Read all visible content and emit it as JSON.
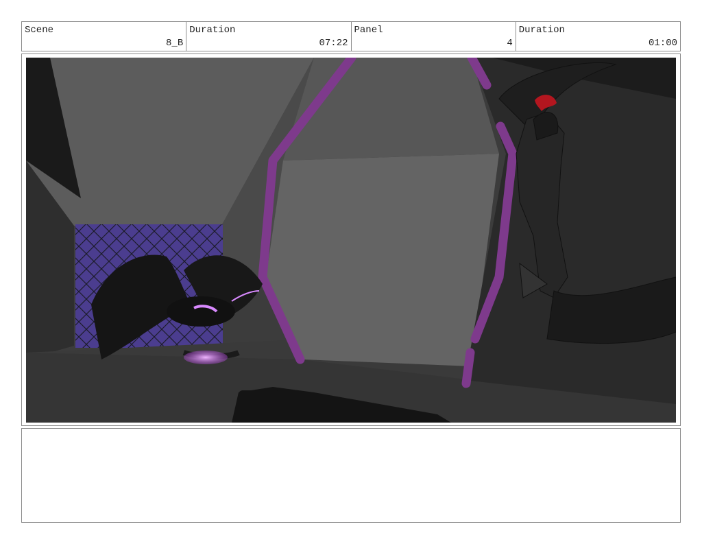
{
  "header": {
    "scene": {
      "label": "Scene",
      "value": "8_B"
    },
    "scene_duration": {
      "label": "Duration",
      "value": "07:22"
    },
    "panel": {
      "label": "Panel",
      "value": "4"
    },
    "panel_duration": {
      "label": "Duration",
      "value": "01:00"
    }
  },
  "artwork": {
    "palette": {
      "wall_light": "#5e5e5e",
      "wall_mid": "#4a4a4a",
      "floor": "#3b3b3b",
      "dark": "#1a1a1a",
      "mesh": "#4b3d8f",
      "accent": "#7e3a8c",
      "glow": "#d98aff",
      "hair": "#b3161f"
    }
  },
  "notes": {
    "text": ""
  }
}
